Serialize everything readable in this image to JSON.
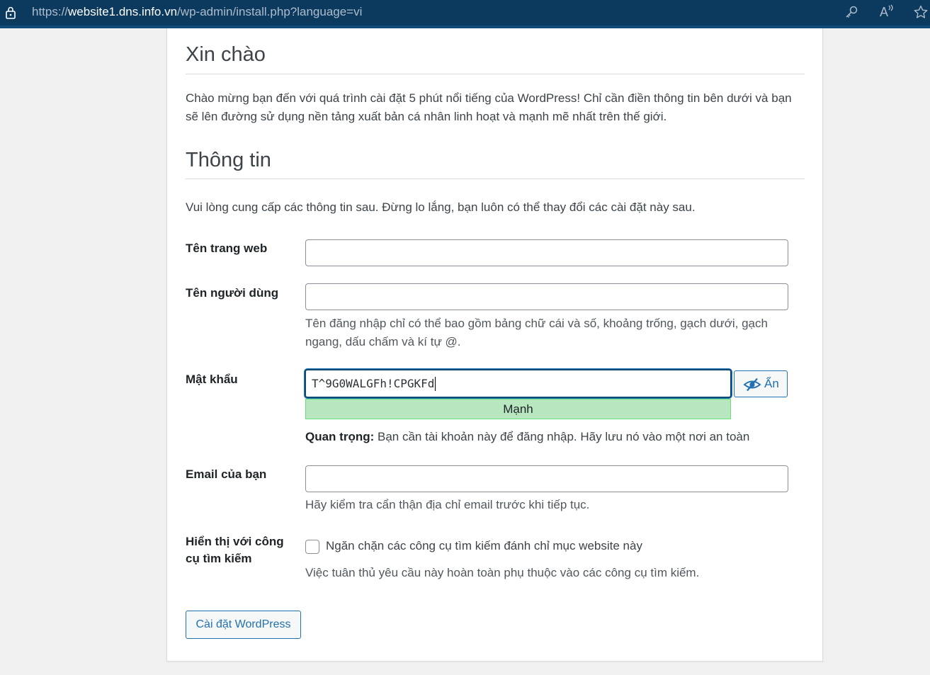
{
  "browser": {
    "url_prefix": "https://",
    "url_host": "website1.dns.info.vn",
    "url_path": "/wp-admin/install.php?language=vi",
    "read_aloud_label": "A",
    "icons": [
      "lock-icon",
      "key-icon",
      "read-aloud-icon",
      "favorite-star-icon"
    ]
  },
  "welcome": {
    "title": "Xin chào",
    "text": "Chào mừng bạn đến với quá trình cài đặt 5 phút nổi tiếng của WordPress! Chỉ cần điền thông tin bên dưới và bạn sẽ lên đường sử dụng nền tảng xuất bản cá nhân linh hoạt và mạnh mẽ nhất trên thế giới."
  },
  "info": {
    "title": "Thông tin",
    "description": "Vui lòng cung cấp các thông tin sau. Đừng lo lắng, bạn luôn có thể thay đổi các cài đặt này sau."
  },
  "form": {
    "site_title": {
      "label": "Tên trang web",
      "value": ""
    },
    "username": {
      "label": "Tên người dùng",
      "value": "",
      "hint": "Tên đăng nhập chỉ có thể bao gồm bảng chữ cái và số, khoảng trống, gạch dưới, gạch ngang, dấu chấm và kí tự @."
    },
    "password": {
      "label": "Mật khẩu",
      "value": "T^9G0WALGFh!CPGKFd",
      "hide_button": "Ẩn",
      "strength": "Mạnh",
      "important_bold": "Quan trọng:",
      "important_text": " Bạn cần tài khoản này để đăng nhập. Hãy lưu nó vào một nơi an toàn"
    },
    "email": {
      "label": "Email của bạn",
      "value": "",
      "hint": "Hãy kiểm tra cẩn thận địa chỉ email trước khi tiếp tục."
    },
    "search_visibility": {
      "label": "Hiển thị với công cụ tìm kiếm",
      "checkbox_label": "Ngăn chặn các công cụ tìm kiếm đánh chỉ mục website này",
      "checked": false,
      "hint": "Việc tuân thủ yêu cầu này hoàn toàn phụ thuộc vào các công cụ tìm kiếm."
    },
    "submit_label": "Cài đặt WordPress"
  },
  "colors": {
    "accent": "#2271b1",
    "strength_bg": "#b8e6bf",
    "addressbar": "#0b3a5e"
  }
}
